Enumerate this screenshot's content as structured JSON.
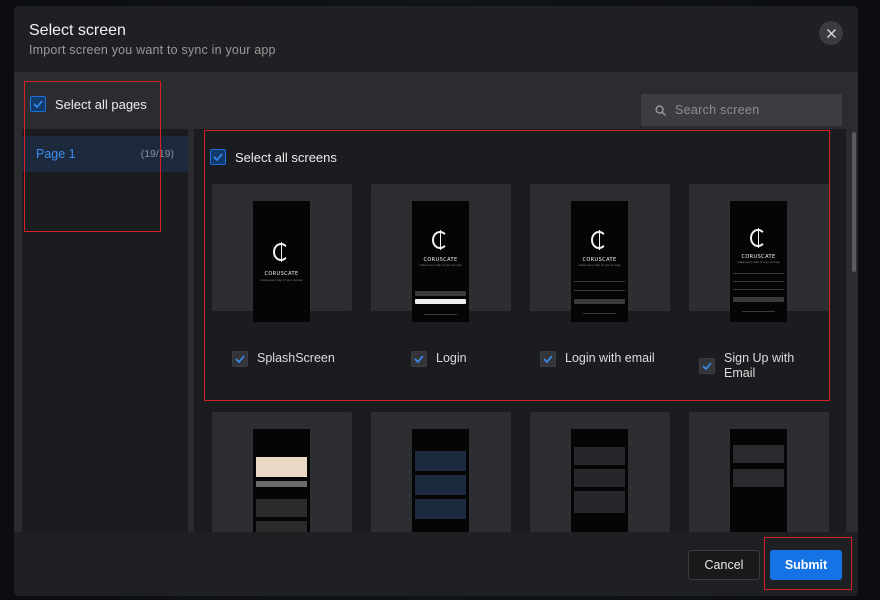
{
  "dialog": {
    "title": "Select screen",
    "subtitle": "Import screen you want to sync in your app"
  },
  "toolbar": {
    "select_all_pages_label": "Select all pages",
    "search_placeholder": "Search screen"
  },
  "sidebar": {
    "pages": [
      {
        "label": "Page 1",
        "count": "(19/19)"
      }
    ]
  },
  "main": {
    "select_all_screens_label": "Select all screens",
    "screens": [
      {
        "label": "SplashScreen",
        "brand": "CORUSCATE",
        "tagline": "make every step of your journey"
      },
      {
        "label": "Login",
        "brand": "CORUSCATE",
        "tagline": "make every step of your journey"
      },
      {
        "label": "Login with email",
        "brand": "CORUSCATE",
        "tagline": "make every step of your journey"
      },
      {
        "label": "Sign Up with Email",
        "brand": "CORUSCATE",
        "tagline": "make every step of your journey"
      }
    ]
  },
  "footer": {
    "cancel_label": "Cancel",
    "submit_label": "Submit"
  },
  "colors": {
    "accent": "#1673e6",
    "highlight": "#d81f26",
    "page_link": "#3a8ef2"
  }
}
